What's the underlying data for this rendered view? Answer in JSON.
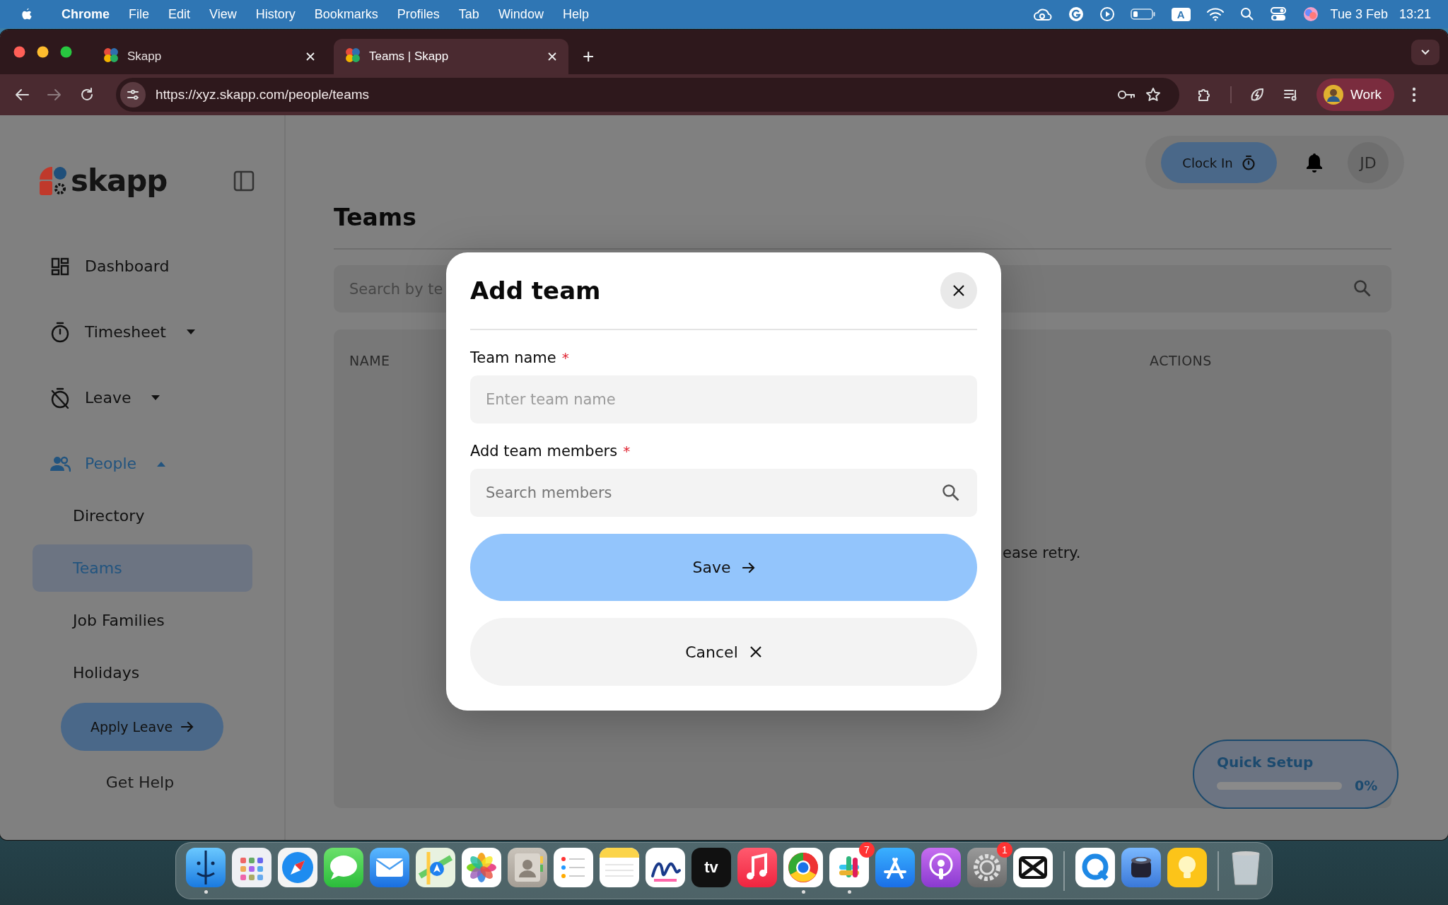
{
  "menu_bar": {
    "app": "Chrome",
    "items": [
      "File",
      "Edit",
      "View",
      "History",
      "Bookmarks",
      "Profiles",
      "Tab",
      "Window",
      "Help"
    ],
    "input_source": "A",
    "date": "Tue 3 Feb",
    "time": "13:21"
  },
  "browser": {
    "tabs": [
      {
        "title": "Skapp",
        "selected": false
      },
      {
        "title": "Teams | Skapp",
        "selected": true
      }
    ],
    "new_tab": "+",
    "url": "https://xyz.skapp.com/people/teams",
    "profile": "Work"
  },
  "sidebar": {
    "brand": "skapp",
    "nav": [
      {
        "label": "Dashboard",
        "selected": false
      },
      {
        "label": "Timesheet",
        "selected": false,
        "expanded": false
      },
      {
        "label": "Leave",
        "selected": false,
        "expanded": false
      },
      {
        "label": "People",
        "selected": true,
        "expanded": true,
        "children": [
          {
            "label": "Directory",
            "selected": false
          },
          {
            "label": "Teams",
            "selected": true
          },
          {
            "label": "Job Families",
            "selected": false
          },
          {
            "label": "Holidays",
            "selected": false
          }
        ]
      }
    ],
    "apply_button": "Apply Leave",
    "help_link": "Get Help"
  },
  "header": {
    "clock_in": "Clock In",
    "avatar": "JD"
  },
  "page": {
    "title": "Teams",
    "search": {
      "placeholder": "Search by te"
    },
    "table": {
      "columns": [
        "NAME",
        "ACTIONS"
      ],
      "message": "ease retry."
    }
  },
  "quick_setup": {
    "title": "Quick Setup",
    "level": 0,
    "reading": "0%"
  },
  "modal": {
    "title": "Add team",
    "fields": [
      {
        "kind": "text",
        "label": "Team name",
        "required_mark": "*",
        "placeholder": "Enter team name"
      },
      {
        "kind": "search",
        "label": "Add team members",
        "required_mark": "*",
        "placeholder": "Search members"
      }
    ],
    "buttons": [
      {
        "kind": "primary",
        "label": "Save"
      },
      {
        "kind": "secondary",
        "label": "Cancel"
      }
    ]
  },
  "dock": {
    "apps": [
      {
        "running": true
      },
      {
        "running": false
      },
      {
        "running": false
      },
      {
        "running": false
      },
      {
        "running": false
      },
      {
        "running": false
      },
      {
        "running": false
      },
      {
        "running": false
      },
      {
        "running": false
      },
      {
        "running": false
      },
      {
        "running": false
      },
      {
        "running": false,
        "label": "tv"
      },
      {
        "running": false
      },
      {
        "running": true
      },
      {
        "running": true,
        "badge": "7"
      },
      {
        "running": false
      },
      {
        "running": false
      },
      {
        "running": false,
        "badge": "1"
      },
      {
        "running": false
      },
      {
        "running": false
      },
      {
        "running": false
      },
      {
        "running": false
      }
    ]
  }
}
